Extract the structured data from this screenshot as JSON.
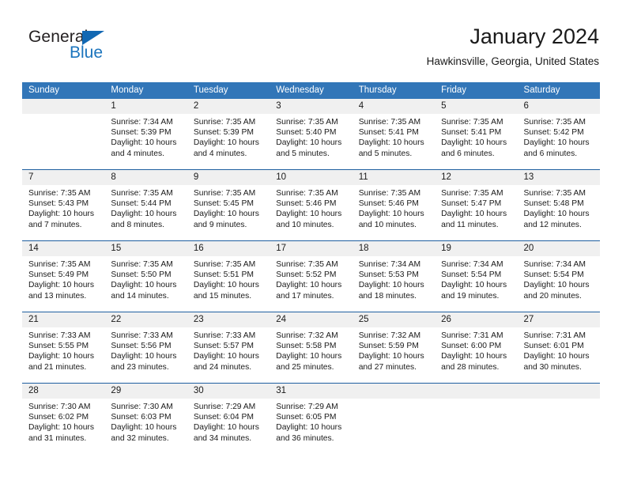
{
  "brand": {
    "name_part1": "General",
    "name_part2": "Blue"
  },
  "header": {
    "title": "January 2024",
    "subtitle": "Hawkinsville, Georgia, United States"
  },
  "colors": {
    "header_blue": "#3276b8",
    "rule_blue": "#1f5fa0",
    "day_band": "#f0f0f0",
    "brand_blue": "#1b74bd"
  },
  "calendar": {
    "day_names": [
      "Sunday",
      "Monday",
      "Tuesday",
      "Wednesday",
      "Thursday",
      "Friday",
      "Saturday"
    ],
    "weeks": [
      [
        {
          "day": "",
          "sunrise": "",
          "sunset": "",
          "daylight_line1": "",
          "daylight_line2": ""
        },
        {
          "day": "1",
          "sunrise": "Sunrise: 7:34 AM",
          "sunset": "Sunset: 5:39 PM",
          "daylight_line1": "Daylight: 10 hours",
          "daylight_line2": "and 4 minutes."
        },
        {
          "day": "2",
          "sunrise": "Sunrise: 7:35 AM",
          "sunset": "Sunset: 5:39 PM",
          "daylight_line1": "Daylight: 10 hours",
          "daylight_line2": "and 4 minutes."
        },
        {
          "day": "3",
          "sunrise": "Sunrise: 7:35 AM",
          "sunset": "Sunset: 5:40 PM",
          "daylight_line1": "Daylight: 10 hours",
          "daylight_line2": "and 5 minutes."
        },
        {
          "day": "4",
          "sunrise": "Sunrise: 7:35 AM",
          "sunset": "Sunset: 5:41 PM",
          "daylight_line1": "Daylight: 10 hours",
          "daylight_line2": "and 5 minutes."
        },
        {
          "day": "5",
          "sunrise": "Sunrise: 7:35 AM",
          "sunset": "Sunset: 5:41 PM",
          "daylight_line1": "Daylight: 10 hours",
          "daylight_line2": "and 6 minutes."
        },
        {
          "day": "6",
          "sunrise": "Sunrise: 7:35 AM",
          "sunset": "Sunset: 5:42 PM",
          "daylight_line1": "Daylight: 10 hours",
          "daylight_line2": "and 6 minutes."
        }
      ],
      [
        {
          "day": "7",
          "sunrise": "Sunrise: 7:35 AM",
          "sunset": "Sunset: 5:43 PM",
          "daylight_line1": "Daylight: 10 hours",
          "daylight_line2": "and 7 minutes."
        },
        {
          "day": "8",
          "sunrise": "Sunrise: 7:35 AM",
          "sunset": "Sunset: 5:44 PM",
          "daylight_line1": "Daylight: 10 hours",
          "daylight_line2": "and 8 minutes."
        },
        {
          "day": "9",
          "sunrise": "Sunrise: 7:35 AM",
          "sunset": "Sunset: 5:45 PM",
          "daylight_line1": "Daylight: 10 hours",
          "daylight_line2": "and 9 minutes."
        },
        {
          "day": "10",
          "sunrise": "Sunrise: 7:35 AM",
          "sunset": "Sunset: 5:46 PM",
          "daylight_line1": "Daylight: 10 hours",
          "daylight_line2": "and 10 minutes."
        },
        {
          "day": "11",
          "sunrise": "Sunrise: 7:35 AM",
          "sunset": "Sunset: 5:46 PM",
          "daylight_line1": "Daylight: 10 hours",
          "daylight_line2": "and 10 minutes."
        },
        {
          "day": "12",
          "sunrise": "Sunrise: 7:35 AM",
          "sunset": "Sunset: 5:47 PM",
          "daylight_line1": "Daylight: 10 hours",
          "daylight_line2": "and 11 minutes."
        },
        {
          "day": "13",
          "sunrise": "Sunrise: 7:35 AM",
          "sunset": "Sunset: 5:48 PM",
          "daylight_line1": "Daylight: 10 hours",
          "daylight_line2": "and 12 minutes."
        }
      ],
      [
        {
          "day": "14",
          "sunrise": "Sunrise: 7:35 AM",
          "sunset": "Sunset: 5:49 PM",
          "daylight_line1": "Daylight: 10 hours",
          "daylight_line2": "and 13 minutes."
        },
        {
          "day": "15",
          "sunrise": "Sunrise: 7:35 AM",
          "sunset": "Sunset: 5:50 PM",
          "daylight_line1": "Daylight: 10 hours",
          "daylight_line2": "and 14 minutes."
        },
        {
          "day": "16",
          "sunrise": "Sunrise: 7:35 AM",
          "sunset": "Sunset: 5:51 PM",
          "daylight_line1": "Daylight: 10 hours",
          "daylight_line2": "and 15 minutes."
        },
        {
          "day": "17",
          "sunrise": "Sunrise: 7:35 AM",
          "sunset": "Sunset: 5:52 PM",
          "daylight_line1": "Daylight: 10 hours",
          "daylight_line2": "and 17 minutes."
        },
        {
          "day": "18",
          "sunrise": "Sunrise: 7:34 AM",
          "sunset": "Sunset: 5:53 PM",
          "daylight_line1": "Daylight: 10 hours",
          "daylight_line2": "and 18 minutes."
        },
        {
          "day": "19",
          "sunrise": "Sunrise: 7:34 AM",
          "sunset": "Sunset: 5:54 PM",
          "daylight_line1": "Daylight: 10 hours",
          "daylight_line2": "and 19 minutes."
        },
        {
          "day": "20",
          "sunrise": "Sunrise: 7:34 AM",
          "sunset": "Sunset: 5:54 PM",
          "daylight_line1": "Daylight: 10 hours",
          "daylight_line2": "and 20 minutes."
        }
      ],
      [
        {
          "day": "21",
          "sunrise": "Sunrise: 7:33 AM",
          "sunset": "Sunset: 5:55 PM",
          "daylight_line1": "Daylight: 10 hours",
          "daylight_line2": "and 21 minutes."
        },
        {
          "day": "22",
          "sunrise": "Sunrise: 7:33 AM",
          "sunset": "Sunset: 5:56 PM",
          "daylight_line1": "Daylight: 10 hours",
          "daylight_line2": "and 23 minutes."
        },
        {
          "day": "23",
          "sunrise": "Sunrise: 7:33 AM",
          "sunset": "Sunset: 5:57 PM",
          "daylight_line1": "Daylight: 10 hours",
          "daylight_line2": "and 24 minutes."
        },
        {
          "day": "24",
          "sunrise": "Sunrise: 7:32 AM",
          "sunset": "Sunset: 5:58 PM",
          "daylight_line1": "Daylight: 10 hours",
          "daylight_line2": "and 25 minutes."
        },
        {
          "day": "25",
          "sunrise": "Sunrise: 7:32 AM",
          "sunset": "Sunset: 5:59 PM",
          "daylight_line1": "Daylight: 10 hours",
          "daylight_line2": "and 27 minutes."
        },
        {
          "day": "26",
          "sunrise": "Sunrise: 7:31 AM",
          "sunset": "Sunset: 6:00 PM",
          "daylight_line1": "Daylight: 10 hours",
          "daylight_line2": "and 28 minutes."
        },
        {
          "day": "27",
          "sunrise": "Sunrise: 7:31 AM",
          "sunset": "Sunset: 6:01 PM",
          "daylight_line1": "Daylight: 10 hours",
          "daylight_line2": "and 30 minutes."
        }
      ],
      [
        {
          "day": "28",
          "sunrise": "Sunrise: 7:30 AM",
          "sunset": "Sunset: 6:02 PM",
          "daylight_line1": "Daylight: 10 hours",
          "daylight_line2": "and 31 minutes."
        },
        {
          "day": "29",
          "sunrise": "Sunrise: 7:30 AM",
          "sunset": "Sunset: 6:03 PM",
          "daylight_line1": "Daylight: 10 hours",
          "daylight_line2": "and 32 minutes."
        },
        {
          "day": "30",
          "sunrise": "Sunrise: 7:29 AM",
          "sunset": "Sunset: 6:04 PM",
          "daylight_line1": "Daylight: 10 hours",
          "daylight_line2": "and 34 minutes."
        },
        {
          "day": "31",
          "sunrise": "Sunrise: 7:29 AM",
          "sunset": "Sunset: 6:05 PM",
          "daylight_line1": "Daylight: 10 hours",
          "daylight_line2": "and 36 minutes."
        },
        {
          "day": "",
          "sunrise": "",
          "sunset": "",
          "daylight_line1": "",
          "daylight_line2": ""
        },
        {
          "day": "",
          "sunrise": "",
          "sunset": "",
          "daylight_line1": "",
          "daylight_line2": ""
        },
        {
          "day": "",
          "sunrise": "",
          "sunset": "",
          "daylight_line1": "",
          "daylight_line2": ""
        }
      ]
    ]
  }
}
